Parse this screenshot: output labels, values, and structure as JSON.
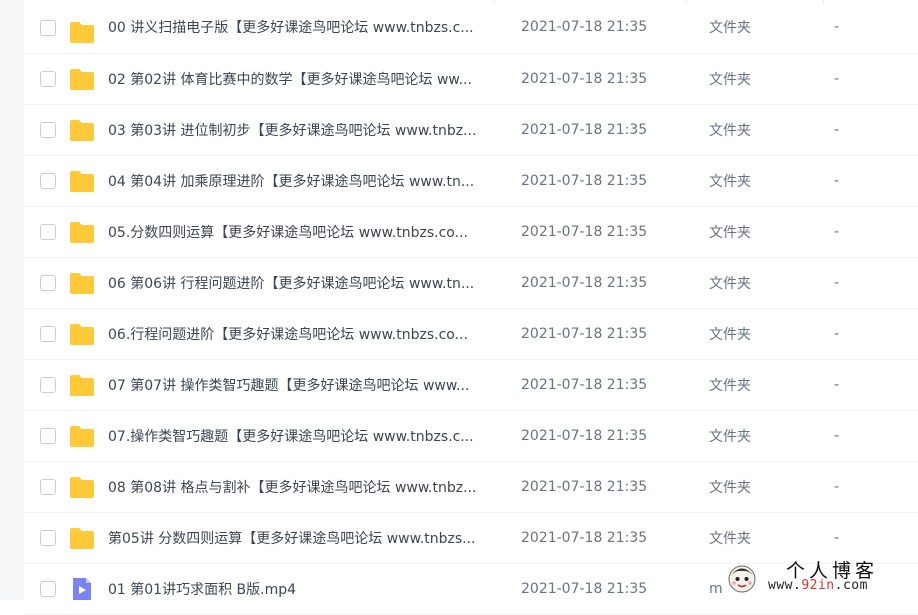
{
  "files": [
    {
      "name": "00 讲义扫描电子版【更多好课途鸟吧论坛 www.tnbzs.c...",
      "date": "2021-07-18 21:35",
      "kind": "文件夹",
      "size": "-",
      "icon": "folder-icon"
    },
    {
      "name": "02 第02讲 体育比赛中的数学【更多好课途鸟吧论坛 ww...",
      "date": "2021-07-18 21:35",
      "kind": "文件夹",
      "size": "-",
      "icon": "folder-icon"
    },
    {
      "name": "03 第03讲 进位制初步【更多好课途鸟吧论坛 www.tnbz...",
      "date": "2021-07-18 21:35",
      "kind": "文件夹",
      "size": "-",
      "icon": "folder-icon"
    },
    {
      "name": "04 第04讲 加乘原理进阶【更多好课途鸟吧论坛 www.tn...",
      "date": "2021-07-18 21:35",
      "kind": "文件夹",
      "size": "-",
      "icon": "folder-icon"
    },
    {
      "name": "05.分数四则运算【更多好课途鸟吧论坛 www.tnbzs.co...",
      "date": "2021-07-18 21:35",
      "kind": "文件夹",
      "size": "-",
      "icon": "folder-icon"
    },
    {
      "name": "06 第06讲 行程问题进阶【更多好课途鸟吧论坛 www.tn...",
      "date": "2021-07-18 21:35",
      "kind": "文件夹",
      "size": "-",
      "icon": "folder-icon"
    },
    {
      "name": "06.行程问题进阶【更多好课途鸟吧论坛 www.tnbzs.co...",
      "date": "2021-07-18 21:35",
      "kind": "文件夹",
      "size": "-",
      "icon": "folder-icon"
    },
    {
      "name": "07 第07讲 操作类智巧趣题【更多好课途鸟吧论坛 www...",
      "date": "2021-07-18 21:35",
      "kind": "文件夹",
      "size": "-",
      "icon": "folder-icon"
    },
    {
      "name": "07.操作类智巧趣题【更多好课途鸟吧论坛 www.tnbzs.c...",
      "date": "2021-07-18 21:35",
      "kind": "文件夹",
      "size": "-",
      "icon": "folder-icon"
    },
    {
      "name": "08 第08讲 格点与割补【更多好课途鸟吧论坛 www.tnbz...",
      "date": "2021-07-18 21:35",
      "kind": "文件夹",
      "size": "-",
      "icon": "folder-icon"
    },
    {
      "name": "第05讲 分数四则运算【更多好课途鸟吧论坛 www.tnbzs...",
      "date": "2021-07-18 21:35",
      "kind": "文件夹",
      "size": "-",
      "icon": "folder-icon"
    },
    {
      "name": "01 第01讲巧求面积 B版.mp4",
      "date": "2021-07-18 21:35",
      "kind": "m",
      "size": "",
      "icon": "video-file-icon"
    }
  ],
  "watermark": {
    "title": "个人博客",
    "url_prefix": "www.",
    "url_highlight": "92in",
    "url_suffix": ".com"
  },
  "colors": {
    "folder": "#ffc93a",
    "video_icon": "#7b83f3",
    "background": "#ffffff"
  }
}
